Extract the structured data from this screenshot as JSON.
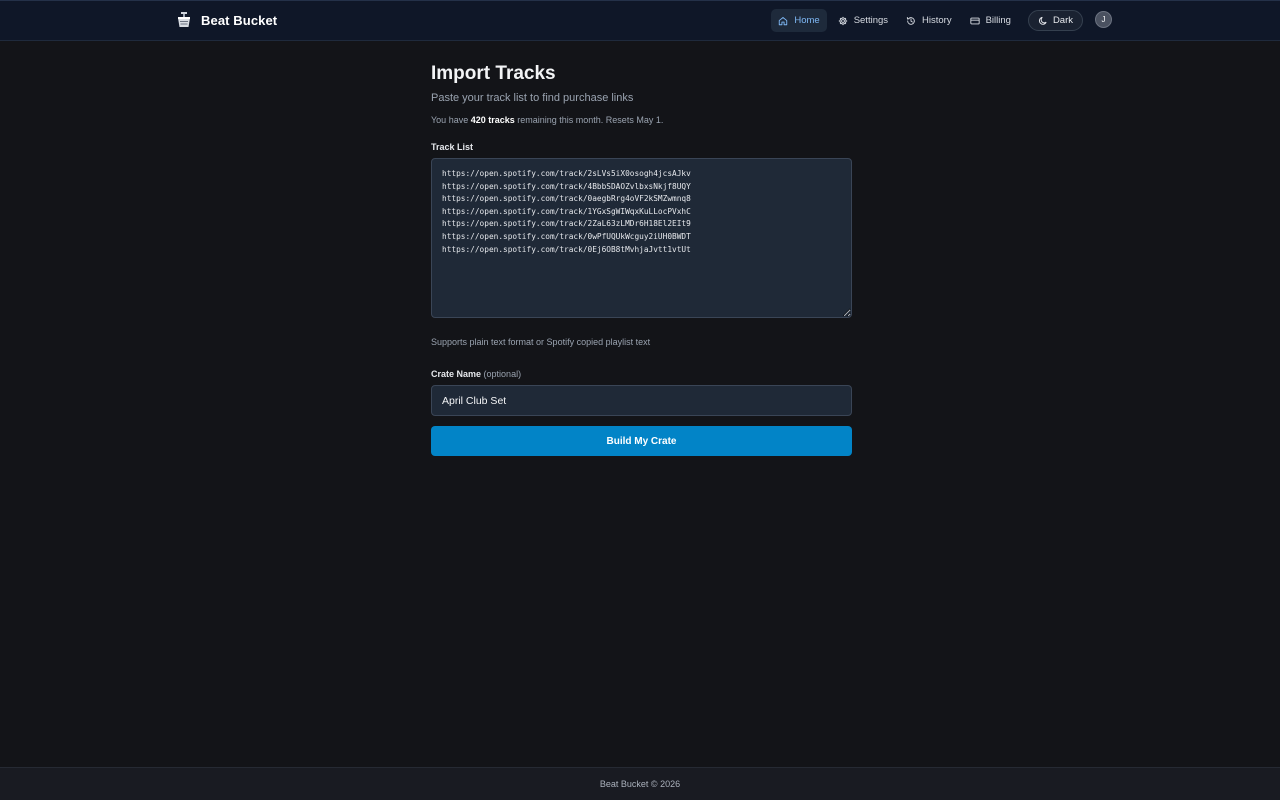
{
  "header": {
    "app_name": "Beat Bucket",
    "logo_icon": "bucket-logo-icon",
    "nav": [
      {
        "label": "Home",
        "icon": "home-icon",
        "active": true
      },
      {
        "label": "Settings",
        "icon": "gear-icon",
        "active": false
      },
      {
        "label": "History",
        "icon": "history-icon",
        "active": false
      },
      {
        "label": "Billing",
        "icon": "credit-card-icon",
        "active": false
      }
    ],
    "theme_toggle": {
      "label": "Dark",
      "icon": "moon-icon"
    },
    "avatar_initial": "J"
  },
  "main": {
    "title": "Import Tracks",
    "subtitle": "Paste your track list to find purchase links",
    "quota": {
      "prefix": "You have ",
      "amount": "420 tracks",
      "suffix": " remaining this month. Resets May 1."
    },
    "track_list": {
      "label": "Track List",
      "value": "https://open.spotify.com/track/2sLVs5iX0osogh4jcsAJkv\nhttps://open.spotify.com/track/4BbbSDAOZvlbxsNkjf8UQY\nhttps://open.spotify.com/track/0aegbRrg4oVF2kSMZwmnq8\nhttps://open.spotify.com/track/1YGxSgWIWqxKuLLocPVxhC\nhttps://open.spotify.com/track/2ZaL63zLMDr6H18El2EIt9\nhttps://open.spotify.com/track/0wPfUQUkWcguy2iUH0BWDT\nhttps://open.spotify.com/track/0Ej6OB8tMvhjaJvtt1vtUt",
      "hint": "Supports plain text format or Spotify copied playlist text"
    },
    "crate_name": {
      "label": "Crate Name",
      "optional_note": "(optional)",
      "value": "April Club Set"
    },
    "submit_label": "Build My Crate"
  },
  "footer": {
    "text": "Beat Bucket © 2026"
  },
  "colors": {
    "background": "#131418",
    "header_bg": "#0f1728",
    "accent": "#0284c7",
    "active_nav_text": "#7fb8f5",
    "field_bg": "#1f2937"
  }
}
